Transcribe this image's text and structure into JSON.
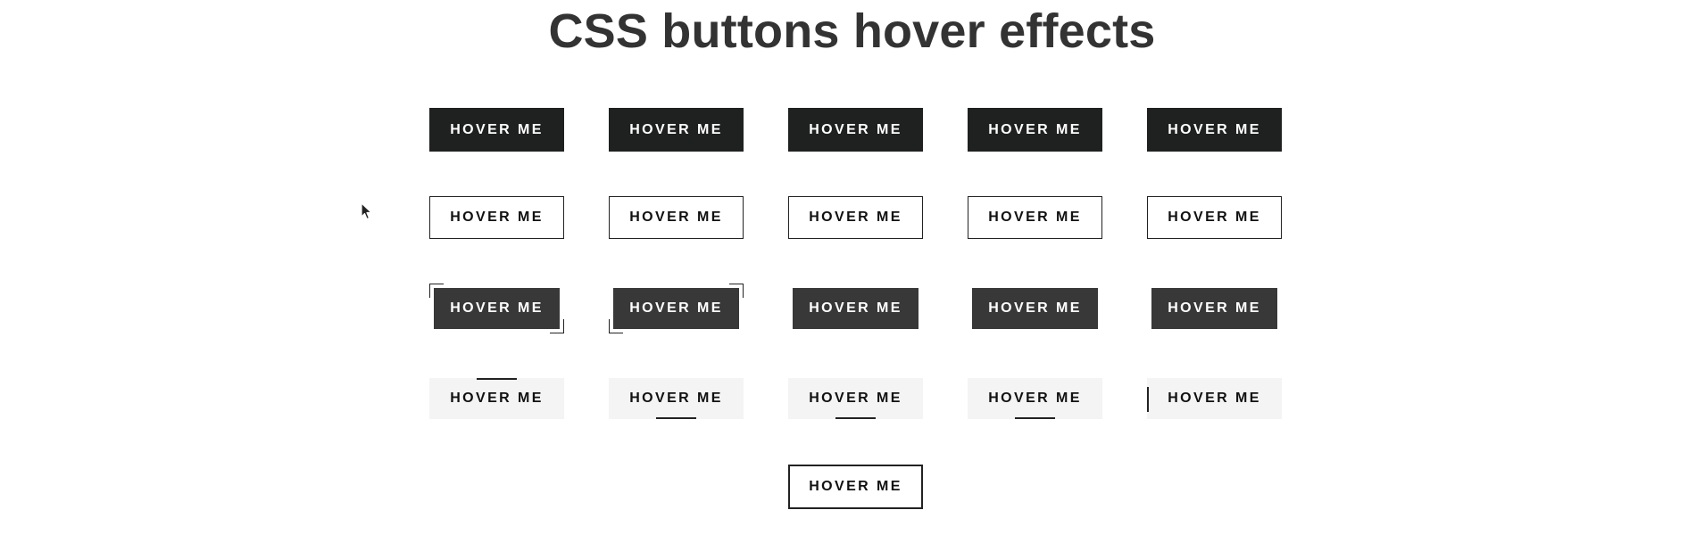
{
  "page": {
    "title": "CSS buttons hover effects"
  },
  "button_label": "HOVER ME",
  "rows": [
    {
      "style": "solid-dark",
      "buttons": [
        "HOVER ME",
        "HOVER ME",
        "HOVER ME",
        "HOVER ME",
        "HOVER ME"
      ]
    },
    {
      "style": "outline",
      "buttons": [
        "HOVER ME",
        "HOVER ME",
        "HOVER ME",
        "HOVER ME",
        "HOVER ME"
      ]
    },
    {
      "style": "solid-gray-corners",
      "buttons": [
        "HOVER ME",
        "HOVER ME",
        "HOVER ME",
        "HOVER ME",
        "HOVER ME"
      ]
    },
    {
      "style": "light-underline",
      "buttons": [
        "HOVER ME",
        "HOVER ME",
        "HOVER ME",
        "HOVER ME",
        "HOVER ME"
      ]
    },
    {
      "style": "outline-bold",
      "buttons": [
        "HOVER ME"
      ]
    }
  ],
  "colors": {
    "dark": "#1f2020",
    "gray": "#383838",
    "light": "#f4f4f4",
    "text": "#333333"
  },
  "icons": {
    "cursor": "mouse-pointer-icon"
  }
}
